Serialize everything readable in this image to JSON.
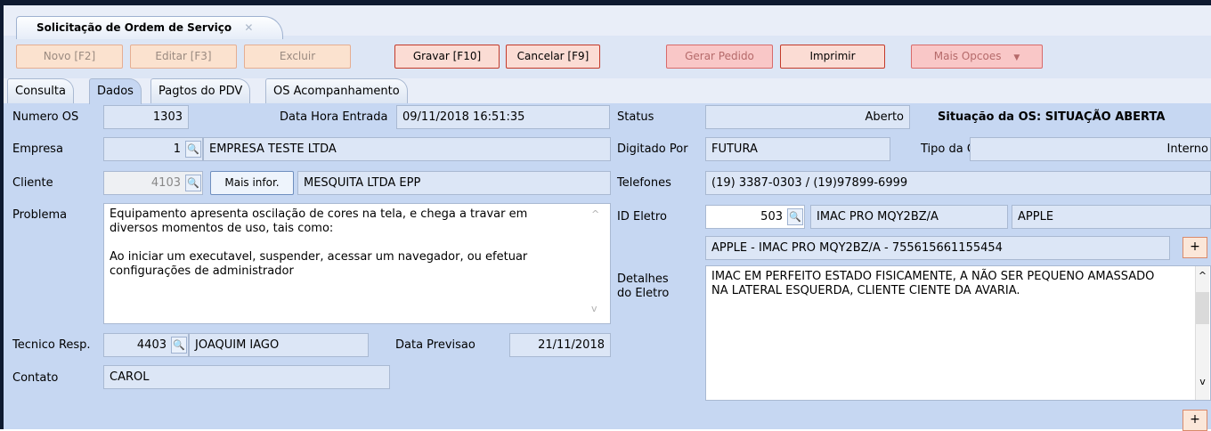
{
  "window": {
    "tab_title": "Solicitação de Ordem de Serviço",
    "tab_close": "✕"
  },
  "toolbar": {
    "novo": "Novo [F2]",
    "editar": "Editar [F3]",
    "excluir": "Excluir",
    "gravar": "Gravar [F10]",
    "cancelar": "Cancelar [F9]",
    "gerar_pedido": "Gerar Pedido",
    "imprimir": "Imprimir",
    "mais_opcoes": "Mais Opcoes"
  },
  "tabs": [
    "Consulta",
    "Dados",
    "Pagtos do PDV",
    "OS Acompanhamento"
  ],
  "form": {
    "numero_os_label": "Numero OS",
    "numero_os": "1303",
    "data_hora_label": "Data Hora Entrada",
    "data_hora": "09/11/2018 16:51:35",
    "status_label": "Status",
    "status": "Aberto",
    "situacao": "Situação da OS: SITUAÇÃO ABERTA",
    "empresa_label": "Empresa",
    "empresa_code": "1",
    "empresa_name": "EMPRESA TESTE LTDA",
    "digitado_label": "Digitado Por",
    "digitado": "FUTURA",
    "tipo_label": "Tipo da OS",
    "tipo": "Interno",
    "cliente_label": "Cliente",
    "cliente_code": "4103",
    "mais_infor": "Mais infor.",
    "cliente_name": "MESQUITA LTDA EPP",
    "telefones_label": "Telefones",
    "telefones": "(19) 3387-0303 / (19)97899-6999",
    "problema_label": "Problema",
    "problema_lines": [
      "Equipamento apresenta oscilação de cores na tela, e chega a travar em",
      "diversos momentos de uso, tais como:",
      "",
      "Ao iniciar um executavel, suspender, acessar um navegador, ou efetuar",
      "configurações de administrador"
    ],
    "id_eletro_label": "ID Eletro",
    "id_eletro": "503",
    "eletro_model": "IMAC PRO MQY2BZ/A",
    "eletro_brand": "APPLE",
    "eletro_full": "APPLE - IMAC PRO MQY2BZ/A - 755615661155454",
    "detalhes_label_1": "Detalhes",
    "detalhes_label_2": "do Eletro",
    "detalhes_lines": [
      "IMAC EM PERFEITO ESTADO FISICAMENTE, A NÃO SER PEQUENO AMASSADO",
      "NA LATERAL ESQUERDA, CLIENTE CIENTE DA AVARIA."
    ],
    "tecnico_label": "Tecnico Resp.",
    "tecnico_code": "4403",
    "tecnico_name": "JOAQUIM IAGO",
    "data_prev_label": "Data Previsao",
    "data_prev": "21/11/2018",
    "contato_label": "Contato",
    "contato": "CAROL",
    "plus": "+",
    "lookup_glyph": "🔍",
    "scroll_up": "^",
    "scroll_down": "v"
  }
}
